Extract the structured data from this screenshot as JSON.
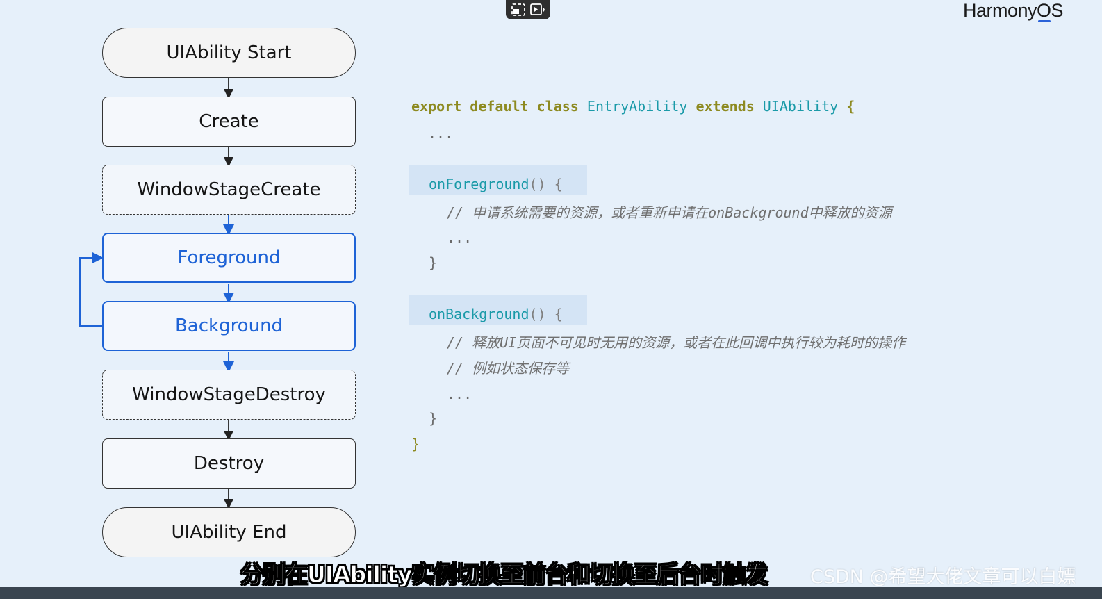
{
  "brand": {
    "prefix": "Harmony",
    "os": "OS"
  },
  "media_controls": {
    "icons": [
      "picture-in-picture-icon",
      "video-effects-icon"
    ]
  },
  "flow": {
    "nodes": [
      {
        "label": "UIAbility Start",
        "shape": "pill"
      },
      {
        "label": "Create",
        "shape": "solid"
      },
      {
        "label": "WindowStageCreate",
        "shape": "dashed"
      },
      {
        "label": "Foreground",
        "shape": "blue"
      },
      {
        "label": "Background",
        "shape": "blue"
      },
      {
        "label": "WindowStageDestroy",
        "shape": "dashed"
      },
      {
        "label": "Destroy",
        "shape": "solid"
      },
      {
        "label": "UIAbility End",
        "shape": "pill"
      }
    ],
    "colors": {
      "highlight": "#1e63d6",
      "default": "#333333"
    }
  },
  "code": {
    "line1": {
      "kw1": "export",
      "kw2": "default",
      "kw3": "class",
      "cls": "EntryAbility",
      "kw4": "extends",
      "base": "UIAbility",
      "brace": "{"
    },
    "ellipsis_top": "...",
    "fg": {
      "name": "onForeground",
      "parens": "()",
      "brace": "{"
    },
    "fg_comment": "// 申请系统需要的资源，或者重新申请在onBackground中释放的资源",
    "fg_ellipsis": "...",
    "fg_close": "}",
    "bg": {
      "name": "onBackground",
      "parens": "()",
      "brace": "{"
    },
    "bg_comment1": "// 释放UI页面不可见时无用的资源，或者在此回调中执行较为耗时的操作",
    "bg_comment2": "// 例如状态保存等",
    "bg_ellipsis": "...",
    "bg_close": "}",
    "class_close": "}"
  },
  "subtitle": "分别在UIAbility实例切换至前台和切换至后台时触发",
  "watermark": "CSDN @希望大佬文章可以白嫖"
}
